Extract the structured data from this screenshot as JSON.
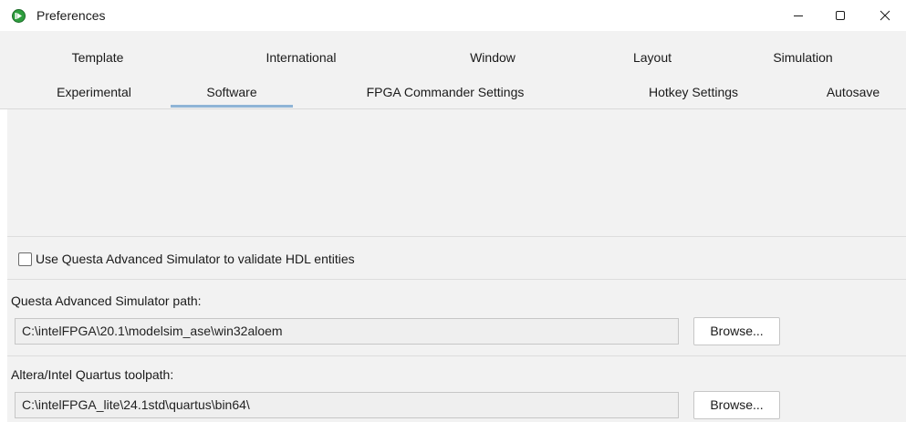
{
  "window": {
    "title": "Preferences",
    "icon": "app-logo-icon",
    "controls": {
      "minimize": "minimize-icon",
      "maximize": "maximize-icon",
      "close": "close-icon"
    }
  },
  "tabs": {
    "row1": [
      "Template",
      "International",
      "Window",
      "Layout",
      "Simulation"
    ],
    "row2": [
      "Experimental",
      "Software",
      "FPGA Commander Settings",
      "Hotkey Settings",
      "Autosave"
    ],
    "active": "Software"
  },
  "software": {
    "questa_checkbox_label": "Use Questa Advanced Simulator to validate HDL entities",
    "questa_checked": false,
    "questa_path_label": "Questa Advanced Simulator path:",
    "questa_path_value": "C:\\intelFPGA\\20.1\\modelsim_ase\\win32aloem",
    "quartus_path_label": "Altera/Intel Quartus toolpath:",
    "quartus_path_value": "C:\\intelFPGA_lite\\24.1std\\quartus\\bin64\\",
    "browse_label": "Browse..."
  },
  "colors": {
    "active_tab_underline": "#8fb4d6",
    "panel_background": "#f2f2f2",
    "app_icon_green": "#2e9e3e"
  }
}
